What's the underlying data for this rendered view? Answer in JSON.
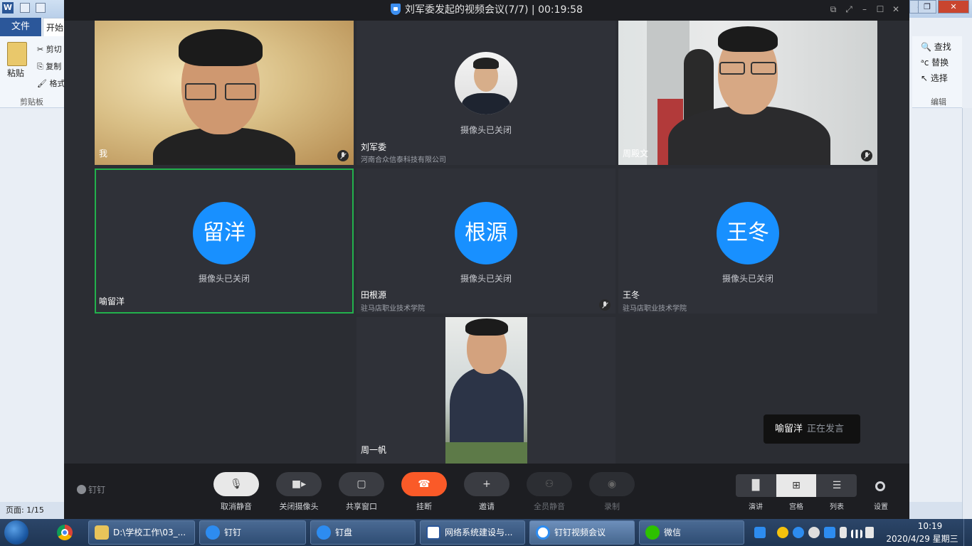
{
  "word": {
    "file_tab": "文件",
    "home_tab": "开始",
    "ribbon": {
      "paste": "粘贴",
      "cut": "剪切",
      "copy": "复制",
      "format": "格式",
      "clipboard": "剪贴板",
      "find": "查找",
      "replace": "替换",
      "select": "选择",
      "edit": "编辑"
    },
    "status_page": "页面: 1/15"
  },
  "meeting": {
    "title": "刘军委发起的视频会议(7/7) | 00:19:58",
    "participants": [
      {
        "name": "我",
        "org": "",
        "camera": "on",
        "muted": true
      },
      {
        "name": "刘军委",
        "org": "河南合众信泰科技有限公司",
        "camera_off_text": "摄像头已关闭",
        "muted": false
      },
      {
        "name": "周殿文",
        "org": "",
        "camera": "on",
        "muted": true
      },
      {
        "name": "喻留洋",
        "org": "",
        "avatar": "留洋",
        "camera_off_text": "摄像头已关闭",
        "muted": false,
        "speaking": true
      },
      {
        "name": "田根源",
        "org": "驻马店职业技术学院",
        "avatar": "根源",
        "camera_off_text": "摄像头已关闭",
        "muted": true
      },
      {
        "name": "王冬",
        "org": "驻马店职业技术学院",
        "avatar": "王冬",
        "camera_off_text": "摄像头已关闭",
        "muted": false
      },
      {
        "name": "周一帆",
        "org": "",
        "camera": "on",
        "muted": false
      }
    ],
    "speaking_name": "喻留洋",
    "speaking_status": "正在发言",
    "brand": "钉钉",
    "toolbar": {
      "unmute": "取消静音",
      "camera_off": "关闭摄像头",
      "share": "共享窗口",
      "hangup": "挂断",
      "invite": "邀请",
      "mute_all": "全员静音",
      "record": "录制"
    },
    "layouts": {
      "speaker": "演讲",
      "grid": "宫格",
      "list": "列表",
      "settings": "设置"
    },
    "colors": {
      "avatar": "#1890ff",
      "hangup": "#fa5a28",
      "active_border": "#22b14c"
    }
  },
  "taskbar": {
    "items": [
      {
        "label": "D:\\学校工作\\03_...",
        "icon": "folder-icon"
      },
      {
        "label": "钉钉",
        "icon": "dingtalk-icon"
      },
      {
        "label": "钉盘",
        "icon": "dingpan-icon"
      },
      {
        "label": "网络系统建设与...",
        "icon": "word-icon"
      },
      {
        "label": "钉钉视频会议",
        "icon": "video-call-icon"
      },
      {
        "label": "微信",
        "icon": "wechat-icon"
      }
    ],
    "time": "10:19",
    "date": "2020/4/29 星期三"
  }
}
